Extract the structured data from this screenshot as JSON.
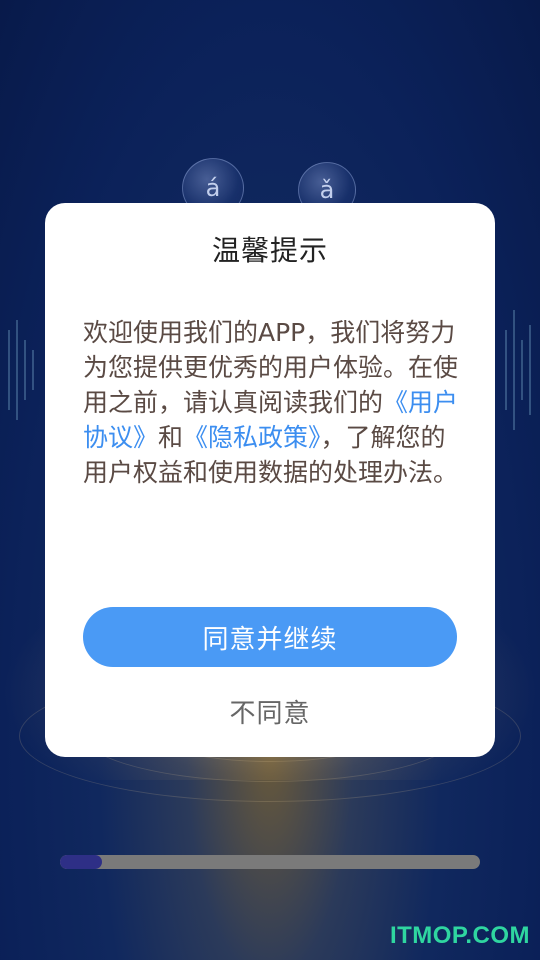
{
  "background": {
    "bubbles": [
      "á",
      "ǎ"
    ]
  },
  "dialog": {
    "title": "温馨提示",
    "message": {
      "part1": "欢迎使用我们的APP，我们将努力为您提供更优秀的用户体验。在使用之前，请认真阅读我们的",
      "user_agreement_link": "《用户协议》",
      "part2": "和",
      "privacy_policy_link": "《隐私政策》",
      "part3": "，了解您的用户权益和使用数据的处理办法。"
    },
    "agree_label": "同意并继续",
    "disagree_label": "不同意"
  },
  "progress": {
    "fraction": 0.1
  },
  "watermark": "ITMOP.COM",
  "colors": {
    "accent": "#4a9af5",
    "link": "#3c8ef0",
    "watermark": "#2fd6a0"
  }
}
